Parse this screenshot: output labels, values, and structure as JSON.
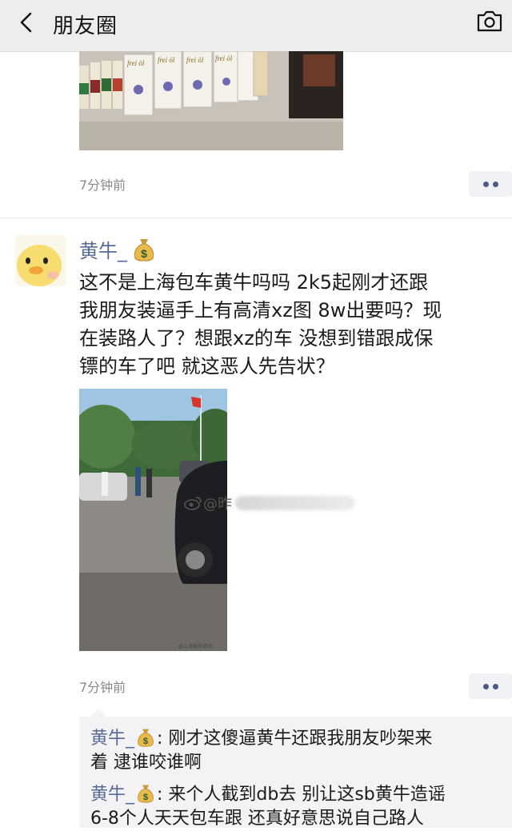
{
  "header": {
    "title": "朋友圈",
    "background": "#ededed"
  },
  "post1": {
    "time": "7分钟前",
    "photo_labels": [
      "frei öl",
      "frei öl",
      "frei öl",
      "frei öl"
    ]
  },
  "post2": {
    "author": "黄牛_",
    "content": "这不是上海包车黄牛吗吗 2k5起刚才还跟\n我朋友装逼手上有高清xz图 8w出要吗？现\n在装路人了？想跟xz的车 没想到错跟成保\n镖的车了吧 就这恶人先告状？",
    "watermark": "@昨",
    "time": "7分钟前"
  },
  "comments": [
    {
      "author": "黄牛_",
      "text": ": 刚才这傻逼黄牛还跟我朋友吵架来\n着 逮谁咬谁啊"
    },
    {
      "author": "黄牛_",
      "text": ": 来个人截到db去 别让这sb黄牛造谣\n6-8个人天天包车跟 还真好意思说自己路人"
    }
  ],
  "colors": {
    "link": "#576b95",
    "time": "#8a8a8a",
    "comment_bg": "#f3f3f5"
  },
  "icons": [
    "back-icon",
    "camera-icon",
    "more-icon",
    "money-bag-icon"
  ]
}
